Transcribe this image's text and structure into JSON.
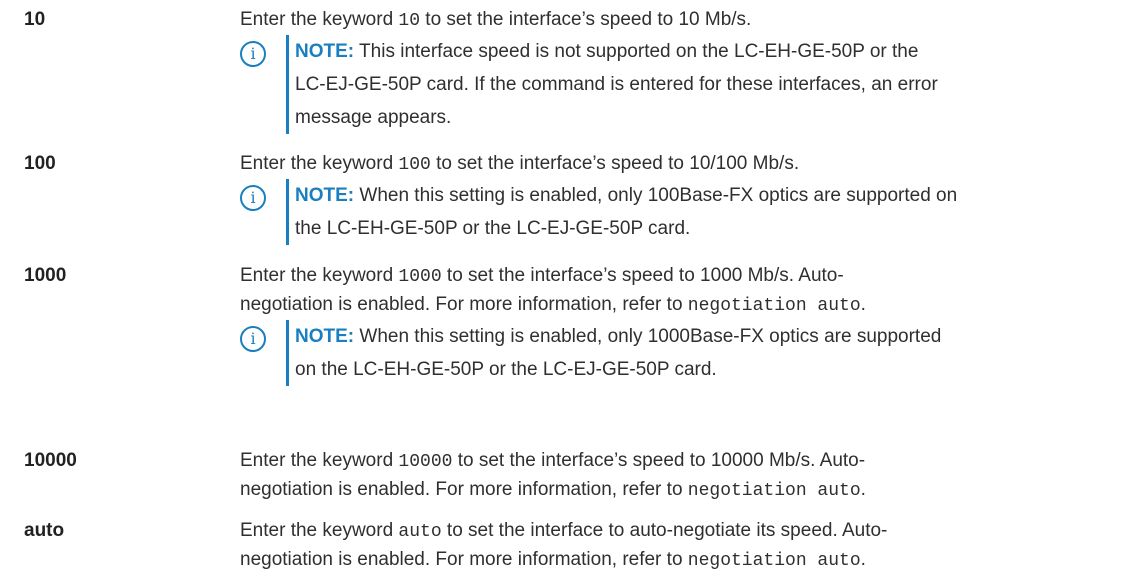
{
  "rows": [
    {
      "term": "10",
      "desc_pre": "Enter the keyword ",
      "desc_code": "10",
      "desc_post": " to set the interface’s speed to 10 Mb/s.",
      "note": {
        "label": "NOTE:",
        "lines": [
          " This interface speed is not supported on the LC-EH-GE-50P or the",
          "LC-EJ-GE-50P card. If the command is entered for these interfaces, an error",
          "message appears."
        ]
      }
    },
    {
      "term": "100",
      "desc_pre": "Enter the keyword ",
      "desc_code": "100",
      "desc_post": " to set the interface’s speed to 10/100 Mb/s.",
      "note": {
        "label": "NOTE:",
        "lines": [
          " When this setting is enabled, only 100Base-FX optics are supported on",
          "the LC-EH-GE-50P or the LC-EJ-GE-50P card."
        ]
      }
    },
    {
      "term": "1000",
      "desc_pre": "Enter the keyword ",
      "desc_code": "1000",
      "desc_post": " to set the interface’s speed to 1000 Mb/s. Auto-",
      "line2_pre": "negotiation is enabled. For more information, refer to ",
      "line2_code": "negotiation auto",
      "line2_post": ".",
      "note": {
        "label": "NOTE:",
        "lines": [
          " When this setting is enabled, only 1000Base-FX optics are supported",
          "on the LC-EH-GE-50P or the LC-EJ-GE-50P card."
        ]
      }
    },
    {
      "term": "10000",
      "desc_pre": "Enter the keyword ",
      "desc_code": "10000",
      "desc_post": " to set the interface’s speed to 10000 Mb/s. Auto-",
      "line2_pre": "negotiation is enabled. For more information, refer to ",
      "line2_code": "negotiation auto",
      "line2_post": "."
    },
    {
      "term": "auto",
      "desc_pre": "Enter the keyword ",
      "desc_code": "auto",
      "desc_post": " to set the interface to auto-negotiate its speed. Auto-",
      "line2_pre": "negotiation is enabled. For more information, refer to ",
      "line2_code": "negotiation auto",
      "line2_post": "."
    }
  ],
  "note_icon": "info-icon",
  "colors": {
    "accent": "#1a7fc0",
    "text": "#2f2f2f"
  }
}
